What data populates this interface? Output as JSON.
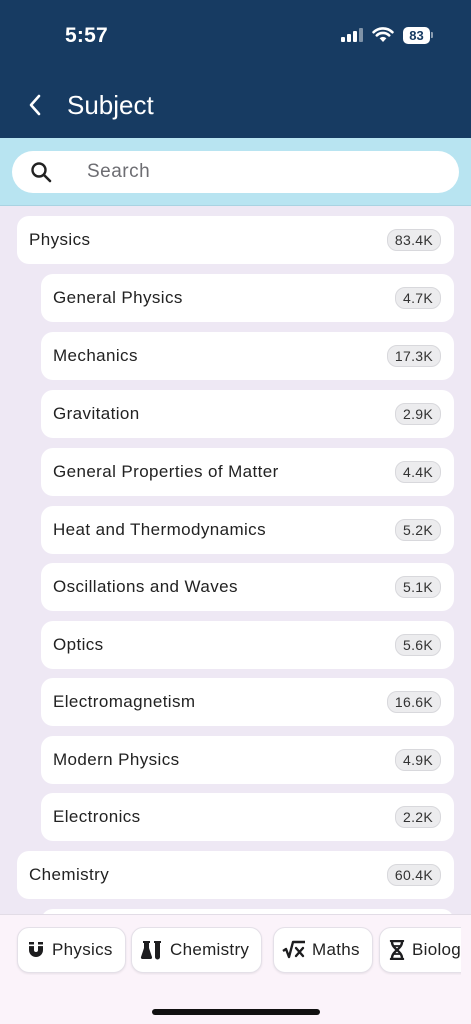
{
  "status_bar": {
    "time": "5:57",
    "battery": "83"
  },
  "header": {
    "title": "Subject"
  },
  "search": {
    "placeholder": "Search"
  },
  "list": [
    {
      "kind": "subject",
      "label": "Physics",
      "count": "83.4K"
    },
    {
      "kind": "topic",
      "label": "General Physics",
      "count": "4.7K"
    },
    {
      "kind": "topic",
      "label": "Mechanics",
      "count": "17.3K"
    },
    {
      "kind": "topic",
      "label": "Gravitation",
      "count": "2.9K"
    },
    {
      "kind": "topic",
      "label": "General Properties of Matter",
      "count": "4.4K"
    },
    {
      "kind": "topic",
      "label": "Heat and Thermodynamics",
      "count": "5.2K"
    },
    {
      "kind": "topic",
      "label": "Oscillations and Waves",
      "count": "5.1K"
    },
    {
      "kind": "topic",
      "label": "Optics",
      "count": "5.6K"
    },
    {
      "kind": "topic",
      "label": "Electromagnetism",
      "count": "16.6K"
    },
    {
      "kind": "topic",
      "label": "Modern Physics",
      "count": "4.9K"
    },
    {
      "kind": "topic",
      "label": "Electronics",
      "count": "2.2K"
    },
    {
      "kind": "subject",
      "label": "Chemistry",
      "count": "60.4K"
    }
  ],
  "bottom_tabs": [
    {
      "label": "Physics",
      "icon": "magnet-icon"
    },
    {
      "label": "Chemistry",
      "icon": "flask-icon"
    },
    {
      "label": "Maths",
      "icon": "square-root-icon"
    },
    {
      "label": "Biolog",
      "icon": "dna-icon"
    }
  ],
  "colors": {
    "header": "#173b62",
    "search_band": "#b8e4f1",
    "background": "#eee8f4"
  }
}
